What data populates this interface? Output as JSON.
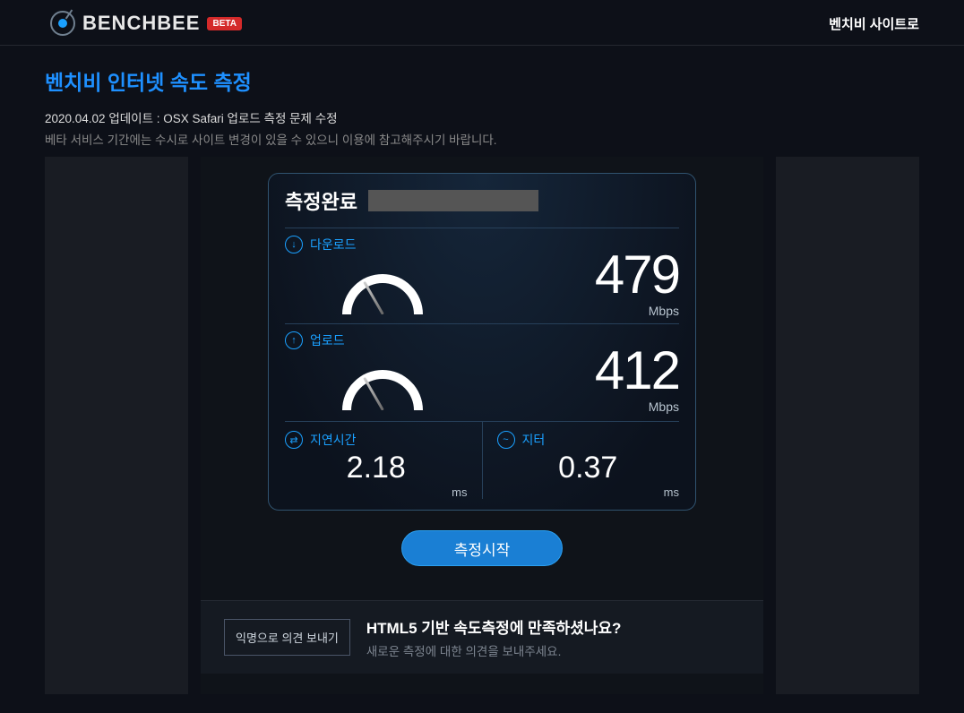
{
  "header": {
    "brand": "BENCHBEE",
    "badge": "BETA",
    "site_link": "벤치비 사이트로"
  },
  "page": {
    "title": "벤치비 인터넷 속도 측정",
    "update_notice": "2020.04.02 업데이트 : OSX Safari 업로드 측정 문제 수정",
    "beta_notice": "베타 서비스 기간에는 수시로 사이트 변경이 있을 수 있으니 이용에 참고해주시기 바랍니다."
  },
  "result": {
    "status": "측정완료",
    "download": {
      "label": "다운로드",
      "value": "479",
      "unit": "Mbps"
    },
    "upload": {
      "label": "업로드",
      "value": "412",
      "unit": "Mbps"
    },
    "latency": {
      "label": "지연시간",
      "value": "2.18",
      "unit": "ms"
    },
    "jitter": {
      "label": "지터",
      "value": "0.37",
      "unit": "ms"
    }
  },
  "action": {
    "start": "측정시작"
  },
  "feedback": {
    "button": "익명으로 의견 보내기",
    "title": "HTML5 기반 속도측정에 만족하셨나요?",
    "subtitle": "새로운 측정에 대한 의견을 보내주세요."
  },
  "icons": {
    "download": "↓",
    "upload": "↑",
    "latency": "⇄",
    "jitter": "~"
  }
}
